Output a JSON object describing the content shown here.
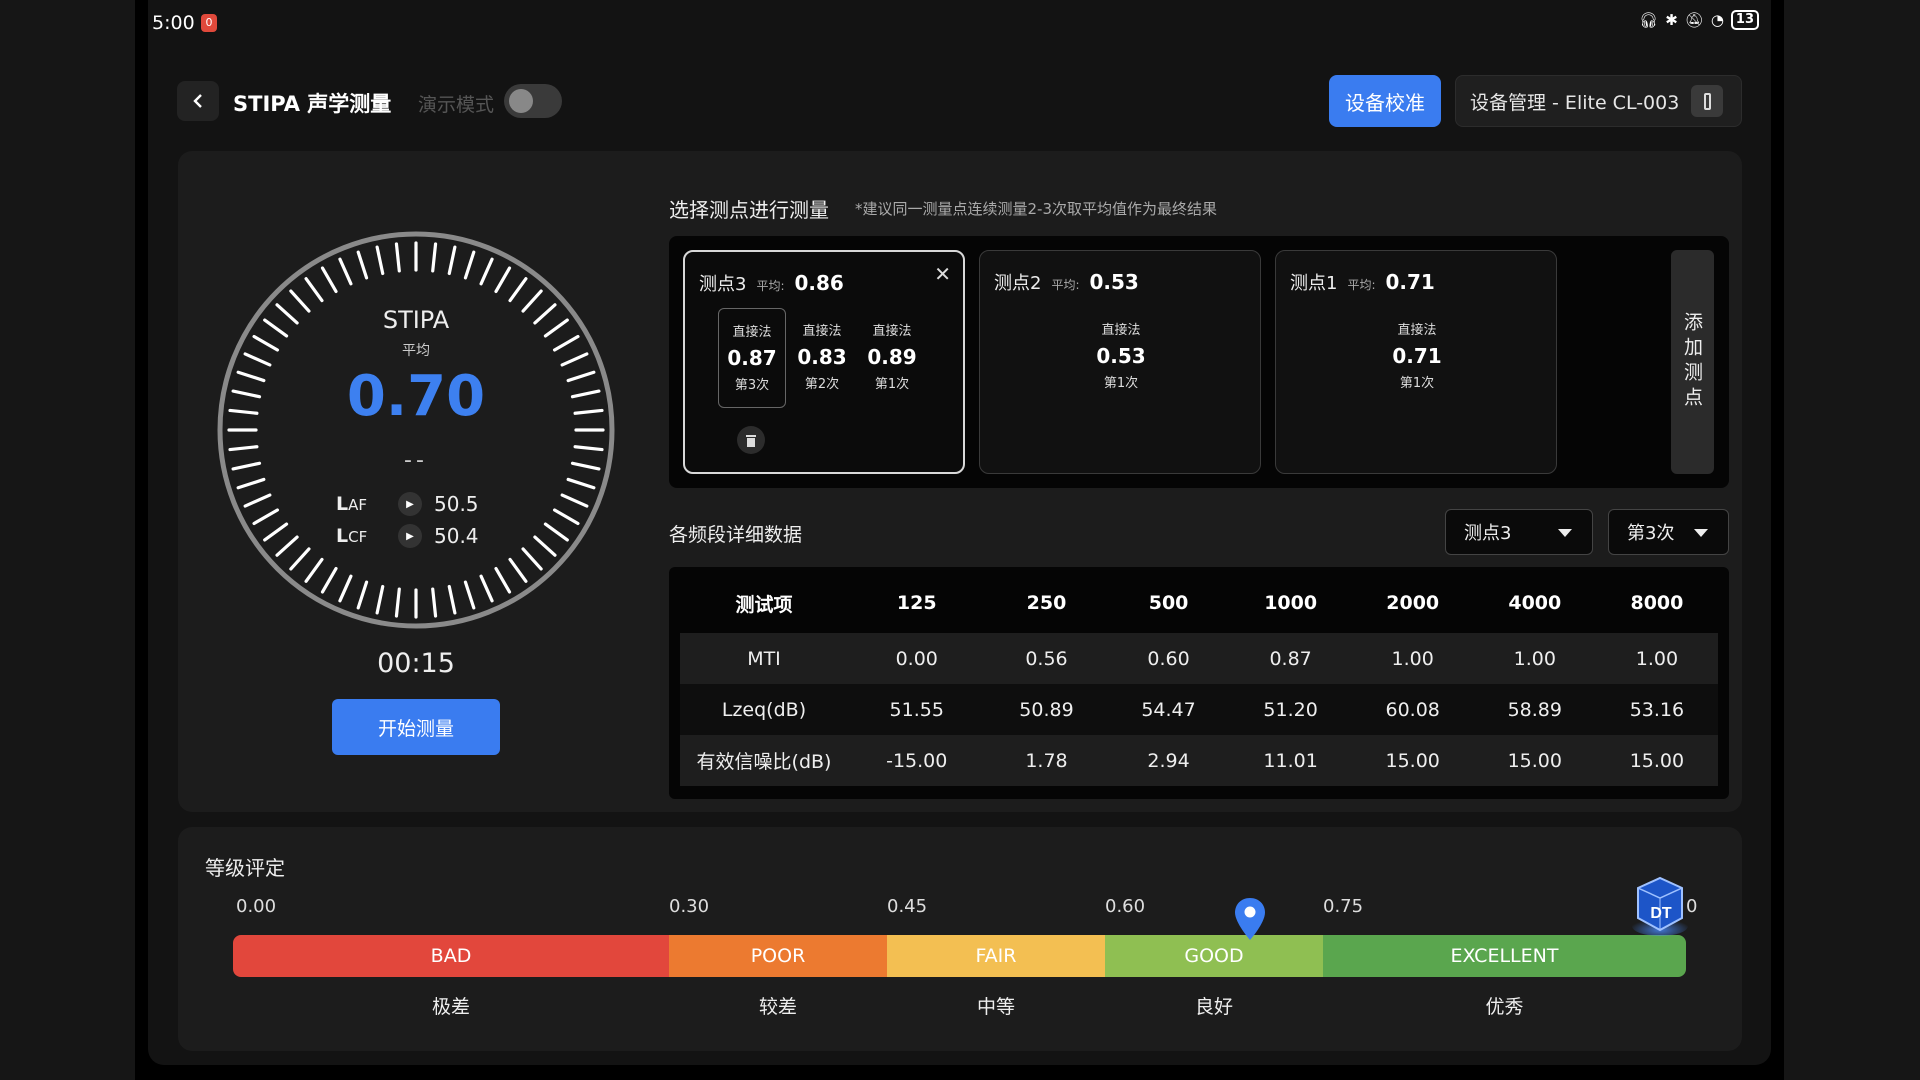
{
  "status_bar": {
    "time": "5:00",
    "notification_count": "0",
    "battery": "13"
  },
  "header": {
    "title": "STIPA 声学测量",
    "demo_mode_label": "演示模式",
    "demo_mode_on": false,
    "calibrate_label": "设备校准",
    "device_label": "设备管理 - Elite CL-003"
  },
  "dial": {
    "title": "STIPA",
    "avg_label": "平均",
    "value": "0.70",
    "sub": "--",
    "laf_label": "L",
    "laf_sub": "AF",
    "laf_value": "50.5",
    "lcf_label": "L",
    "lcf_sub": "CF",
    "lcf_value": "50.4",
    "timer": "00:15",
    "start_label": "开始测量"
  },
  "points": {
    "title": "选择测点进行测量",
    "note": "*建议同一测量点连续测量2-3次取平均值作为最终结果",
    "avg_label": "平均:",
    "add_label": "添加测点",
    "cards": [
      {
        "name": "测点3",
        "avg": "0.86",
        "measurements": [
          {
            "method": "直接法",
            "value": "0.87",
            "index": "第3次"
          },
          {
            "method": "直接法",
            "value": "0.83",
            "index": "第2次"
          },
          {
            "method": "直接法",
            "value": "0.89",
            "index": "第1次"
          }
        ]
      },
      {
        "name": "测点2",
        "avg": "0.53",
        "measurements": [
          {
            "method": "直接法",
            "value": "0.53",
            "index": "第1次"
          }
        ]
      },
      {
        "name": "测点1",
        "avg": "0.71",
        "measurements": [
          {
            "method": "直接法",
            "value": "0.71",
            "index": "第1次"
          }
        ]
      }
    ]
  },
  "bands": {
    "title": "各频段详细数据",
    "point_select": "测点3",
    "run_select": "第3次",
    "headers": [
      "测试项",
      "125",
      "250",
      "500",
      "1000",
      "2000",
      "4000",
      "8000"
    ],
    "rows": [
      [
        "MTI",
        "0.00",
        "0.56",
        "0.60",
        "0.87",
        "1.00",
        "1.00",
        "1.00"
      ],
      [
        "Lzeq(dB)",
        "51.55",
        "50.89",
        "54.47",
        "51.20",
        "60.08",
        "58.89",
        "53.16"
      ],
      [
        "有效信噪比(dB)",
        "-15.00",
        "1.78",
        "2.94",
        "11.01",
        "15.00",
        "15.00",
        "15.00"
      ]
    ]
  },
  "grade": {
    "title": "等级评定",
    "ticks": [
      "0.00",
      "0.30",
      "0.45",
      "0.60",
      "0.75",
      "0"
    ],
    "segments": [
      {
        "en": "BAD",
        "cn": "极差",
        "color": "#e2473c"
      },
      {
        "en": "POOR",
        "cn": "较差",
        "color": "#ec7a30"
      },
      {
        "en": "FAIR",
        "cn": "中等",
        "color": "#f3bf52"
      },
      {
        "en": "GOOD",
        "cn": "良好",
        "color": "#8fbf52"
      },
      {
        "en": "EXCELLENT",
        "cn": "优秀",
        "color": "#5aa64e"
      }
    ],
    "marker_value": 0.7,
    "logo_text": "DT"
  }
}
